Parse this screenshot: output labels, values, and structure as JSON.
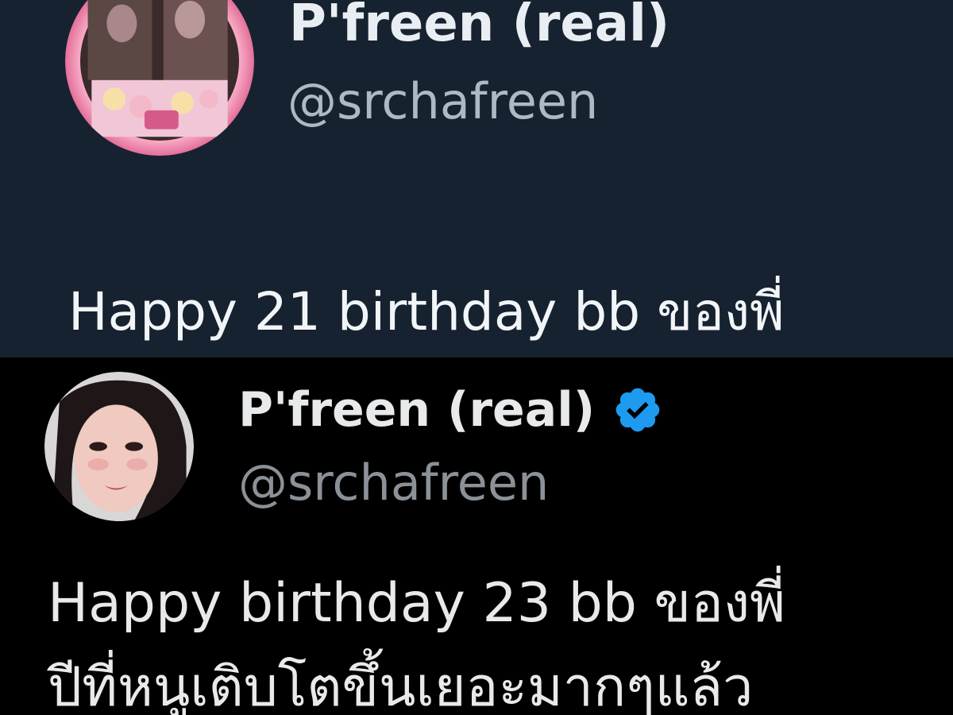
{
  "top_tweet": {
    "display_name": "P'freen (real)",
    "handle": "@srchafreen",
    "text": "Happy 21 birthday bb ของพี่",
    "avatar_icon": "profile-photo-birthday-frame"
  },
  "bottom_tweet": {
    "display_name": "P'freen (real)",
    "handle": "@srchafreen",
    "verified": true,
    "verified_icon": "verified-badge-icon",
    "verified_color": "#1d9bf0",
    "text_line1": "Happy birthday 23 bb ของพี่",
    "text_line2": "ปีที่หนูเติบโตขึ้นเยอะมากๆแล้ว",
    "avatar_icon": "profile-photo-portrait"
  },
  "colors": {
    "top_background": "#172230",
    "bottom_background": "#000000"
  }
}
